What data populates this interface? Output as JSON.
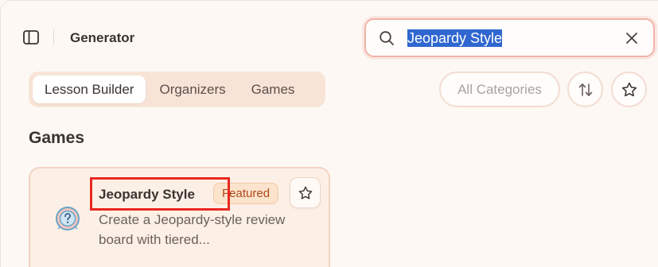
{
  "header": {
    "title": "Generator",
    "sidebar_toggle_icon": "sidebar-panel-icon"
  },
  "search": {
    "value": "Jeopardy Style",
    "icon": "search-icon",
    "clear_icon": "close-icon"
  },
  "tabs": [
    {
      "label": "Lesson Builder",
      "active": true
    },
    {
      "label": "Organizers",
      "active": false
    },
    {
      "label": "Games",
      "active": false
    }
  ],
  "toolbar": {
    "category_label": "All Categories",
    "sort_icon": "sort-arrows-icon",
    "favorites_icon": "star-icon"
  },
  "section": {
    "title": "Games"
  },
  "card": {
    "title": "Jeopardy Style",
    "badge": "Featured",
    "description": "Create a Jeopardy-style review board with tiered...",
    "icon": "question-mark-icon",
    "favorite_icon": "star-icon"
  },
  "colors": {
    "accent": "#f0b3a8",
    "selection": "#2f66d0",
    "highlight_box": "#e8281f",
    "badge_text": "#b0481b"
  }
}
